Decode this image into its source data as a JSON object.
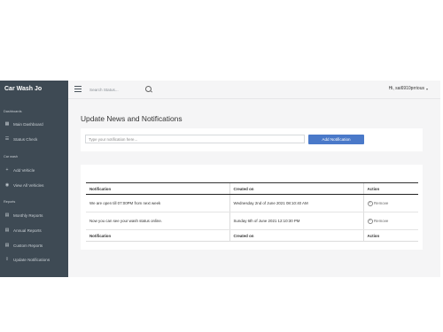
{
  "sidebar": {
    "brand": "Car Wash Jo",
    "sections": [
      {
        "label": "Dashboards",
        "items": [
          {
            "icon": "grid-icon",
            "label": "Main Dashboard"
          },
          {
            "icon": "list-icon",
            "label": "Status Check"
          }
        ]
      },
      {
        "label": "Car wash",
        "items": [
          {
            "icon": "plus-icon",
            "label": "Add Vehicle"
          },
          {
            "icon": "eye-icon",
            "label": "View All Vehicles"
          }
        ]
      },
      {
        "label": "Reports",
        "items": [
          {
            "icon": "report-icon",
            "label": "Monthly Reports"
          },
          {
            "icon": "report-icon",
            "label": "Annual Reports"
          },
          {
            "icon": "report-icon",
            "label": "Custom Reports"
          },
          {
            "icon": "upload-icon",
            "label": "Update Notifications"
          }
        ]
      }
    ]
  },
  "topbar": {
    "search_placeholder": "Search Status...",
    "user": "Hi, sai6910prrious"
  },
  "page": {
    "title": "Update News and Notifications"
  },
  "form": {
    "placeholder": "Type your notification here...",
    "button": "Add Notification"
  },
  "table": {
    "headers": [
      "Notification",
      "Created on",
      "Action"
    ],
    "rows": [
      {
        "notification": "We are open till 07:00PM from next week",
        "created": "Wednesday 2nd of June 2021 08:10:40 AM",
        "action": "Remove"
      },
      {
        "notification": "Now you can see your wash status online.",
        "created": "Sunday 6th of June 2021 12:10:30 PM",
        "action": "Remove"
      }
    ],
    "footer": [
      "Notification",
      "Created on",
      "Action"
    ]
  }
}
